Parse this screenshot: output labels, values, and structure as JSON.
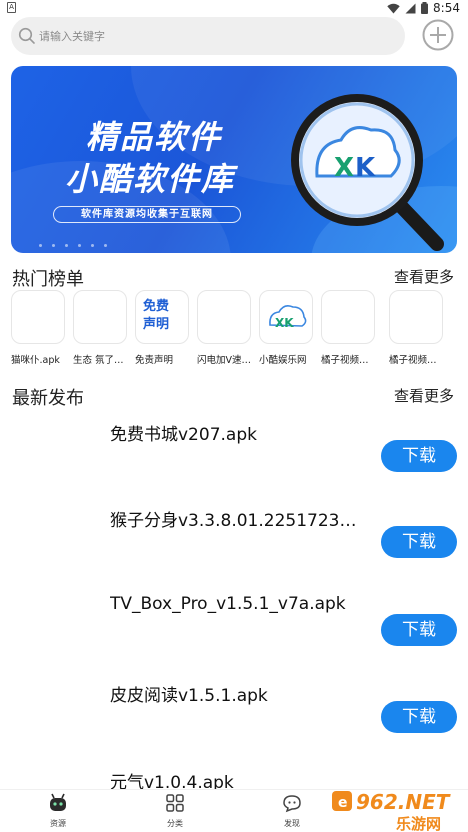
{
  "status_bar": {
    "left_icon": "A",
    "time": "8:54",
    "icons": [
      "wifi-icon",
      "signal-icon",
      "battery-icon"
    ]
  },
  "search": {
    "placeholder": "请输入关键字"
  },
  "banner": {
    "line1": "精品软件",
    "line2": "小酷软件库",
    "subtitle": "软件库资源均收集于互联网",
    "logo_text": "XK"
  },
  "hot": {
    "title": "热门榜单",
    "more": "查看更多",
    "items": [
      {
        "name": "猫咪仆.apk",
        "icon": "blank"
      },
      {
        "name": "生态 氛了…",
        "icon": "blank"
      },
      {
        "name": "免责声明",
        "icon": "free-statement",
        "tile_text_1": "免费",
        "tile_text_2": "声明"
      },
      {
        "name": "闪电加V速…",
        "icon": "blank"
      },
      {
        "name": "小酷娱乐网",
        "icon": "xk-logo",
        "tile_text_1": "XK"
      },
      {
        "name": "橘子视频…",
        "icon": "blank"
      },
      {
        "name": "橘子视频…",
        "icon": "blank"
      }
    ]
  },
  "latest": {
    "title": "最新发布",
    "more": "查看更多",
    "download_label": "下载",
    "items": [
      {
        "name": "免费书城v207.apk"
      },
      {
        "name": "猴子分身v3.3.8.01.2251723…"
      },
      {
        "name": "TV_Box_Pro_v1.5.1_v7a.apk"
      },
      {
        "name": "皮皮阅读v1.5.1.apk"
      },
      {
        "name": "元气v1.0.4.apk"
      }
    ]
  },
  "bottom_nav": {
    "items": [
      {
        "label": "资源",
        "icon": "robot-icon"
      },
      {
        "label": "分类",
        "icon": "grid-icon"
      },
      {
        "label": "发现",
        "icon": "chat-face-icon"
      }
    ]
  },
  "watermark": {
    "text_top": "962.NET",
    "text_bottom": "乐游网"
  },
  "colors": {
    "accent": "#1a86ee",
    "banner": "#1e63e6"
  }
}
